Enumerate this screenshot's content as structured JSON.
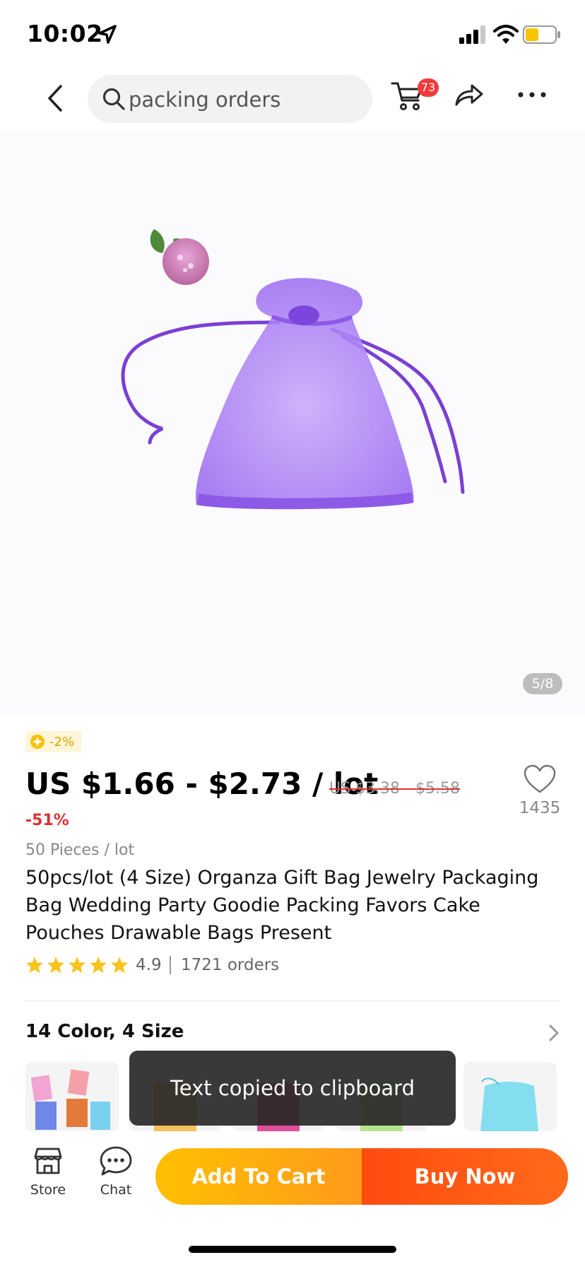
{
  "status_bar": {
    "time": "10:02"
  },
  "nav": {
    "search_text": "packing orders",
    "cart_badge": "73"
  },
  "product": {
    "image_counter": "5/8",
    "coin_discount": "-2%",
    "price": "US $1.66 - $2.73 / lot",
    "original_price": "US $3.38 - $5.58",
    "discount": "-51%",
    "wishlist_count": "1435",
    "pieces": "50 Pieces / lot",
    "title": "50pcs/lot (4 Size) Organza Gift Bag Jewelry Packaging Bag Wedding Party Goodie Packing Favors Cake Pouches Drawable Bags Present",
    "rating": "4.9",
    "orders": "1721 orders",
    "star_count": 5
  },
  "variants": {
    "label": "14 Color, 4 Size"
  },
  "toast": {
    "message": "Text copied to clipboard"
  },
  "bottom_bar": {
    "store_label": "Store",
    "chat_label": "Chat",
    "add_to_cart_label": "Add To Cart",
    "buy_now_label": "Buy Now"
  },
  "colors": {
    "accent_red": "#e03030",
    "add_to_cart_gradient": [
      "#ffc000",
      "#ff9a1c"
    ],
    "buy_now_gradient": [
      "#ff4b10",
      "#ff6a1a"
    ],
    "star": "#f7c41f",
    "bag_purple": "#9c6df0"
  }
}
